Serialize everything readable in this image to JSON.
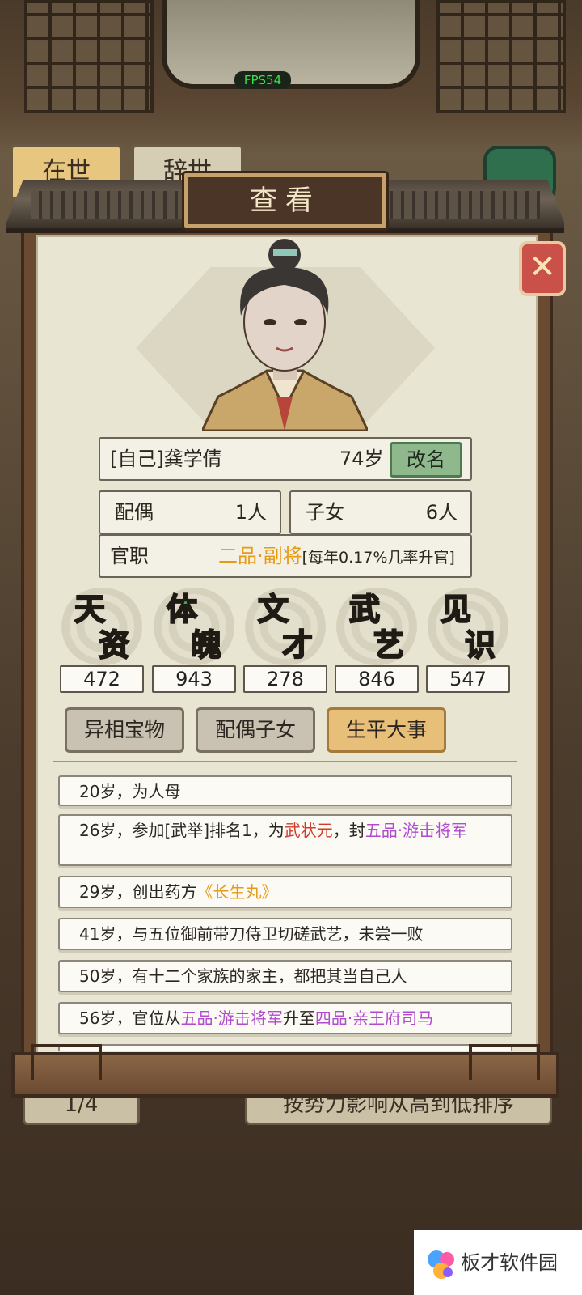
{
  "overlay": {
    "fps": "FPS54"
  },
  "background": {
    "tab_alive": "在世",
    "tab_deceased": "辞世",
    "pager": "1/4",
    "sort_label": "按势力影响从高到低排序"
  },
  "dialog": {
    "title": "查看",
    "close_icon": "close-x-icon"
  },
  "profile": {
    "name": "[自己]龚学倩",
    "age": "74岁",
    "rename_label": "改名",
    "spouse_label": "配偶",
    "spouse_value": "1人",
    "children_label": "子女",
    "children_value": "6人",
    "office_label": "官职",
    "office_rank": "二品·副将",
    "office_note": "[每年0.17%几率升官]"
  },
  "attributes": [
    {
      "c1": "天",
      "c2": "资",
      "value": "472",
      "color": "#3c7de0"
    },
    {
      "c1": "体",
      "c2": "魄",
      "value": "943",
      "color": "#3fae5a"
    },
    {
      "c1": "文",
      "c2": "才",
      "value": "278",
      "color": "#b04bd6"
    },
    {
      "c1": "武",
      "c2": "艺",
      "value": "846",
      "color": "#e6a43a"
    },
    {
      "c1": "见",
      "c2": "识",
      "value": "547",
      "color": "#e0706a"
    }
  ],
  "tabs": {
    "treasures": "异相宝物",
    "family": "配偶子女",
    "life_events": "生平大事"
  },
  "events": {
    "e1": "20岁，为人母",
    "e2_a": "26岁，参加[武举]排名1，为",
    "e2_b": "武状元",
    "e2_c": "，封",
    "e2_d": "五品·游击将军",
    "e3_a": "29岁，创出药方",
    "e3_b": "《长生丸》",
    "e4": "41岁，与五位御前带刀侍卫切磋武艺，未尝一败",
    "e5": "50岁，有十二个家族的家主，都把其当自己人",
    "e6_a": "56岁，官位从",
    "e6_b": "五品·游击将军",
    "e6_c": "升至",
    "e6_d": "四品·亲王府司马"
  },
  "watermark": {
    "text": "板才软件园"
  }
}
